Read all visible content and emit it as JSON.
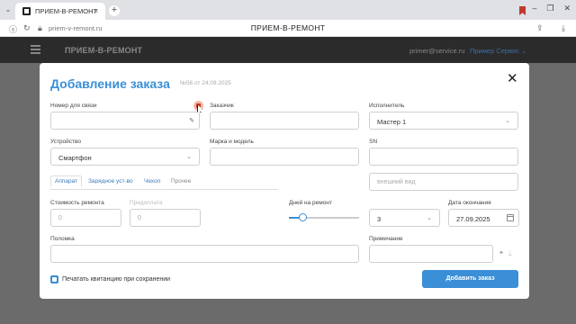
{
  "browser": {
    "tab_title": "ПРИЕМ-В-РЕМОНТ",
    "tab_close": "×",
    "new_tab": "+",
    "address_url": "priem-v-remont.ru",
    "page_title": "ПРИЕМ-В-РЕМОНТ"
  },
  "header": {
    "logo": "ПРИЕМ-В-РЕМОНТ",
    "email": "primer@service.ru",
    "org": "Пример Сервис ⌄"
  },
  "modal": {
    "title": "Добавление заказа",
    "subtitle": "№56 от 24.09.2025",
    "fields": {
      "phone_label": "Номер для связи",
      "customer_label": "Заказчик",
      "executor_label": "Исполнитель",
      "executor_value": "Мастер 1",
      "device_label": "Устройство",
      "device_value": "Смартфон",
      "brand_label": "Марка и модель",
      "sn_label": "SN",
      "appearance_placeholder": "внешний вид",
      "cost_label": "Стоимость ремонта",
      "cost_value": "0",
      "prepay_label": "Предоплата",
      "prepay_value": "0",
      "days_label": "Дней на ремонт",
      "days_value": "3",
      "enddate_label": "Дата окончания",
      "enddate_value": "27.09.2025",
      "fault_label": "Поломка",
      "note_label": "Примечание"
    },
    "tabs": [
      "Аппарат",
      "Зарядное уст-во",
      "Чехол",
      "Прочее"
    ],
    "print_checkbox": "Печатать квитанцию при сохранении",
    "submit": "Добавить заказ"
  }
}
